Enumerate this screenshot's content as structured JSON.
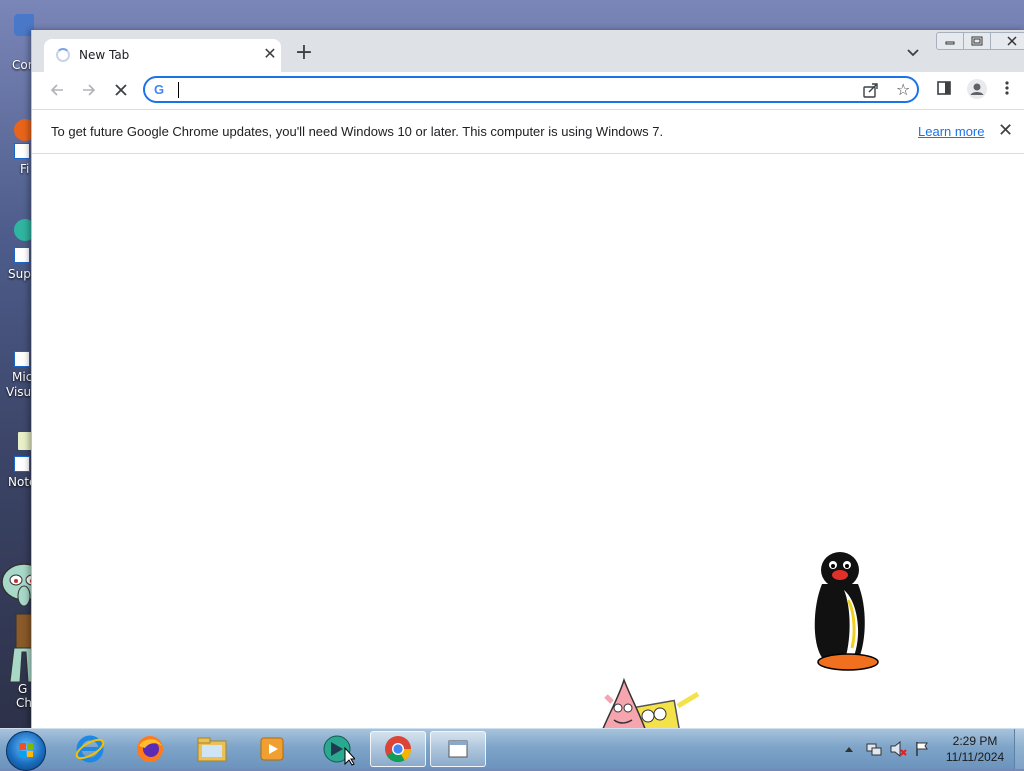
{
  "desktop": {
    "icons": [
      {
        "label": "Cor"
      },
      {
        "label": "Fi"
      },
      {
        "label": "Supe"
      },
      {
        "label": "Mic"
      },
      {
        "label": "Visua"
      },
      {
        "label": "Note"
      },
      {
        "label": "G"
      },
      {
        "label": "Ch"
      }
    ]
  },
  "browser": {
    "tab": {
      "title": "New Tab"
    },
    "omnibox": {
      "value": "",
      "placeholder": ""
    },
    "infobar": {
      "message": "To get future Google Chrome updates, you'll need Windows 10 or later. This computer is using Windows 7.",
      "link": "Learn more"
    }
  },
  "taskbar": {
    "items": [
      {
        "icon": "internet-explorer-icon"
      },
      {
        "icon": "firefox-icon"
      },
      {
        "icon": "file-explorer-icon"
      },
      {
        "icon": "media-player-icon"
      },
      {
        "icon": "app-icon"
      },
      {
        "icon": "chrome-icon",
        "active": true
      },
      {
        "icon": "window-icon"
      }
    ],
    "clock": {
      "time": "2:29 PM",
      "date": "11/11/2024"
    }
  },
  "colors": {
    "accent": "#1a73e8",
    "tabstrip": "#dee1e6",
    "taskbar": "#7ea4c8"
  }
}
